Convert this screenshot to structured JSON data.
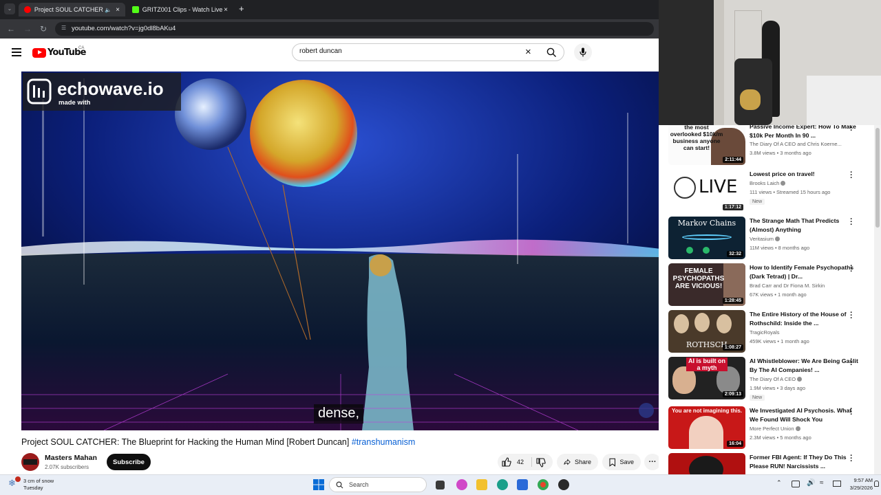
{
  "browser": {
    "tabs": [
      {
        "label": "Project SOUL CATCHER: Th",
        "active": true
      },
      {
        "label": "GRITZ001 Clips - Watch Live on",
        "active": false
      }
    ],
    "new_tab": "+",
    "url": "youtube.com/watch?v=jg0dl8bAKu4"
  },
  "masthead": {
    "logo": "YouTube",
    "country": "CA",
    "search_value": "robert duncan"
  },
  "player": {
    "caption": "dense,",
    "watermark_line1": "echowave.io",
    "watermark_line2": "made with"
  },
  "video": {
    "title": "Project SOUL CATCHER: The Blueprint for Hacking the Human Mind [Robert Duncan]",
    "hashtag": "#transhumanism",
    "channel": "Masters Mahan",
    "subscribers": "2.07K subscribers",
    "subscribe_label": "Subscribe",
    "likes": "42",
    "share_label": "Share",
    "save_label": "Save"
  },
  "recommendations": [
    {
      "title": "Passive Income Expert: How To Make $10k Per Month In 90 ...",
      "channel": "The Diary Of A CEO and Chris Koerne...",
      "meta": "3.8M views • 3 months ago",
      "duration": "2:11:44",
      "thumb_text": "the most overlooked $10k/m business anyone can start!",
      "verified": true
    },
    {
      "title": "Lowest price on travel!",
      "channel": "Brooks Laich",
      "meta": "111 views • Streamed 15 hours ago",
      "duration": "1:17:12",
      "badge": "New",
      "thumb_text": "LIVE",
      "verified": true
    },
    {
      "title": "The Strange Math That Predicts (Almost) Anything",
      "channel": "Veritasium",
      "meta": "11M views • 8 months ago",
      "duration": "32:32",
      "thumb_text": "Markov Chains",
      "verified": true
    },
    {
      "title": "How to Identify Female Psychopaths (Dark Tetrad) | Dr...",
      "channel": "Brad Carr and Dr Fiona M. Sirkin",
      "meta": "67K views • 1 month ago",
      "duration": "1:28:45",
      "thumb_text": "FEMALE PSYCHOPATHS ARE VICIOUS!",
      "verified": false
    },
    {
      "title": "The Entire History of the House of Rothschild: Inside the ...",
      "channel": "TragicRoyals",
      "meta": "459K views • 1 month ago",
      "duration": "1:08:27",
      "thumb_text": "ROTHSCH",
      "verified": false
    },
    {
      "title": "AI Whistleblower: We Are Being Gaslit By The AI Companies! ...",
      "channel": "The Diary Of A CEO",
      "meta": "1.9M views • 3 days ago",
      "duration": "2:09:13",
      "badge": "New",
      "thumb_text": "AI is built on a myth",
      "verified": true
    },
    {
      "title": "We Investigated AI Psychosis. What We Found Will Shock You",
      "channel": "More Perfect Union",
      "meta": "2.3M views • 5 months ago",
      "duration": "16:04",
      "thumb_text": "You are not imagining this.",
      "verified": true
    },
    {
      "title": "Former FBI Agent: If They Do This Please RUN! Narcissists ...",
      "channel": "",
      "meta": "",
      "duration": "",
      "thumb_text": "",
      "verified": false
    }
  ],
  "taskbar": {
    "weather": "3 cm of snow",
    "weather_day": "Tuesday",
    "search_label": "Search",
    "time": "9:57 AM",
    "date": "3/29/2026"
  },
  "colors": {
    "youtube_red": "#ff0000",
    "link_blue": "#065fd4",
    "browser_dark": "#202124"
  }
}
